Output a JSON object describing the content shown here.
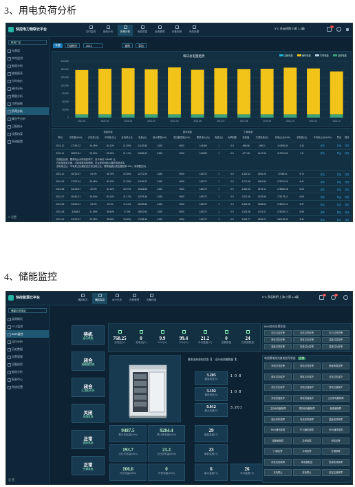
{
  "section3": {
    "title": "3、用电负荷分析",
    "app_name": "快控电力物联云平台",
    "nav": [
      "实时监测",
      "能耗分析",
      "负荷分析",
      "电能质量",
      "运维管理",
      "设备档案",
      "系统设置"
    ],
    "weather": "5°C 多云转阴 小雨 1-3级",
    "sidebar_select": "所有厂区",
    "sidebar": [
      "仪表盘",
      "实时监测",
      "能耗分析",
      "能耗报表",
      "分时电价",
      "碳排分析",
      "需量分析",
      "功率因数",
      "负荷分析",
      "峰谷平分析",
      "日报统计",
      "设备档案",
      "系统配置"
    ],
    "sidebar_active_index": 8,
    "sidebar_footer": "© 设置",
    "filter": {
      "tab1": "年度",
      "tab2": "日度统计",
      "year": "2021",
      "query": "查询",
      "export": "导出"
    },
    "chart_data": {
      "type": "bar",
      "title": "每日总电量趋势",
      "legend": [
        "尖峰电量",
        "峰时电量",
        "平时电量",
        "谷时电量"
      ],
      "legend_colors": [
        "#1db5d8",
        "#f2c41a",
        "#b6cde0",
        "#3aa37a"
      ],
      "categories": [
        "2021-01",
        "2021-02",
        "2021-03",
        "2021-04",
        "2021-05",
        "2021-06",
        "2021-07",
        "2021-08",
        "2021-09",
        "2021-10",
        "2021-11",
        "2021-12"
      ],
      "y_ticks": [
        "210,000",
        "180,000",
        "150,000",
        "120,000",
        "90,000",
        "60,000",
        "30,000",
        "0"
      ],
      "series": [
        {
          "name": "峰时电量",
          "values": [
            165000,
            170000,
            172000,
            168000,
            175000,
            166000,
            172000,
            169000,
            170000,
            174000,
            171000,
            160000
          ]
        },
        {
          "name": "谷时电量",
          "values": [
            12000,
            12000,
            12000,
            12000,
            12000,
            12000,
            12000,
            12000,
            12000,
            12000,
            12000,
            12000
          ]
        }
      ],
      "ylim": [
        0,
        210000
      ]
    },
    "table": {
      "group_headers": [
        "电量电费",
        "基本电费",
        "力调电费"
      ],
      "headers": [
        "时间",
        "总电量(kWh)",
        "尖电量占比",
        "平电量占比",
        "谷电量占比",
        "电费(元)",
        "最大需量(kW)",
        "变压器容量(kVA)",
        "需量电价(元)",
        "电费(元)",
        "功率因数",
        "标准值",
        "力调电费(元)",
        "总电价(元/kWh)",
        "总电费(元)",
        "平均电价(元/kWh)",
        "导出",
        "操作"
      ],
      "rows": [
        [
          "2021-12",
          "27190.72",
          "26.45%",
          "50.12%",
          "21.29%",
          "13139.58",
          "2435",
          "9000",
          "104286",
          "1",
          "0.9",
          "-666.56",
          "1495.1",
          "110695.04",
          "4.34",
          "详情",
          "导出",
          "详情"
        ],
        [
          "2021-11",
          "26570.24",
          "29.54%",
          "33.15%",
          "21.17%",
          "12655.22",
          "2435",
          "9000",
          "104286",
          "1",
          "0.9",
          "-677.26",
          "1417.66",
          "117301.63",
          "4.5",
          "详情",
          "导出",
          "详情"
        ],
        [
          "2021-10",
          "26732.57",
          "24.9%",
          "46.73%",
          "22.05%",
          "12712.29",
          "2435",
          "9000",
          "162372",
          "1",
          "0.9",
          "-1320.02",
          "1690.25",
          "176454.1",
          "5.74",
          "详情",
          "导出",
          "详情"
        ],
        [
          "2021-09",
          "27237.54",
          "26.45%",
          "50.12%",
          "21.29%",
          "13169.27",
          "2435",
          "9000",
          "162372",
          "1",
          "0.9",
          "-1271.06",
          "1581.56",
          "175791.91",
          "6.41",
          "详情",
          "导出",
          "详情"
        ],
        [
          "2021-08",
          "34149.07",
          "22.9%",
          "40.12%",
          "16.97%",
          "16426.58",
          "2435",
          "9000",
          "162372",
          "1",
          "0.9",
          "-1340.06",
          "1879.14",
          "178550.06",
          "5.25",
          "详情",
          "导出",
          "详情"
        ],
        [
          "2021-07",
          "26181.31",
          "26.54%",
          "50.12%",
          "21.17%",
          "12675.38",
          "2435",
          "9000",
          "162372",
          "1",
          "0.9",
          "-1312.06",
          "1425.55",
          "175175.11",
          "6.69",
          "详情",
          "导出",
          "详情"
        ],
        [
          "2021-06",
          "33220.31",
          "23.5%",
          "29.1%",
          "17.41%",
          "16053.82",
          "2435",
          "9000",
          "162372",
          "1",
          "0.9",
          "-1326.06",
          "1835.63",
          "178901.21",
          "5.37",
          "详情",
          "导出",
          "详情"
        ],
        [
          "2021-05",
          "32068.2",
          "21.09%",
          "39.54%",
          "17.3%",
          "15622.84",
          "2435",
          "9000",
          "162372",
          "1",
          "0.9",
          "-1323.06",
          "1761.01",
          "178235.73",
          "5.56",
          "详情",
          "导出",
          "详情"
        ],
        [
          "2021-04",
          "31237.67",
          "26.25%",
          "39.66%",
          "16.89%",
          "17998.46",
          "2435",
          "9000",
          "162372",
          "1",
          "0.9",
          "-1349.77",
          "1826.07",
          "180448.59",
          "5.41",
          "详情",
          "导出",
          "详情"
        ]
      ],
      "note_lines": [
        "在峰谷比例、需求电价分时段影响下，对于每月 156485 元，",
        "在用电费用方面，当前调整用电策略，在谷电时间段以降低电费成本。",
        "总电量占比：平电量占比偏高至达到当前占比；需量值超出变压器容量 40%，有调整空间。"
      ]
    }
  },
  "section4": {
    "title": "4、储能监控",
    "app_name": "快控能源云平台",
    "nav": [
      "储能概况",
      "储能监控",
      "运行分析",
      "告警管理",
      "设备档案"
    ],
    "nav_active_index": 1,
    "weather": "5°C 多云转阴 上海 小雨 1-3级",
    "sidebar_select": "储能示范电站",
    "sidebar": [
      "监测概况",
      "PCS监控",
      "BMS监控",
      "运行分析",
      "历史数据",
      "告警管理",
      "设备档案",
      "能效分析",
      "报表中心",
      "系统设置"
    ],
    "sidebar_active_index": 2,
    "sidebar_footer": "设 置",
    "status_cards": [
      {
        "value": "待机",
        "label": "运行状态"
      },
      {
        "value": "闭合",
        "label": "接触器状态"
      },
      {
        "value": "闭合",
        "label": "汇流柜开关"
      },
      {
        "value": "关闭",
        "label": "风扇状态"
      },
      {
        "value": "正常",
        "label": "消防状态"
      },
      {
        "value": "正常",
        "label": "空调状态"
      }
    ],
    "kpis": [
      {
        "value": "768.25",
        "label": "总电压(V)"
      },
      {
        "value": "0",
        "label": "总电流(A)"
      },
      {
        "value": "9.9",
        "label": "SOC(%)"
      },
      {
        "value": "99.4",
        "label": "SOH(%)"
      },
      {
        "value": "21.2",
        "label": "平均温度(℃)"
      },
      {
        "value": "0",
        "label": "告警数量"
      },
      {
        "value": "24",
        "label": "在线簇数量"
      }
    ],
    "cluster_status": {
      "label1": "簇电池充放电状态",
      "val1": "1",
      "label2": "运行电池簇数量",
      "val2": "1"
    },
    "cell_stats": [
      {
        "value": "3.205",
        "label": "最高电压(V)",
        "sub": "1  0  8"
      },
      {
        "value": "3.192",
        "label": "最低电压(V)",
        "sub": "1  0  8"
      },
      {
        "value": "0.012",
        "label": "最大压差(V)",
        "sub": "3.201"
      }
    ],
    "energy": [
      {
        "value": "9487.5",
        "label": "累计充电量(kWh)"
      },
      {
        "value": "9284.4",
        "label": "累计放电量(kWh)"
      },
      {
        "value": "193.7",
        "label": "当日充电量(kWh)"
      },
      {
        "value": "21.2",
        "label": "当日放电量(kWh)"
      },
      {
        "value": "166.6",
        "label": "可充电量(kWh)"
      },
      {
        "value": "0",
        "label": "可放电量(kWh)"
      }
    ],
    "temps": [
      {
        "value": "29",
        "label": "最高温度(℃)"
      },
      {
        "value": "23",
        "label": "最低温度(℃)"
      },
      {
        "value": "6",
        "label": "最大温差(℃)"
      },
      {
        "value": "26",
        "label": "平均温度(℃)"
      }
    ],
    "alarm_panel_title": "BMS综合告警状态",
    "alarm_buttons": [
      "总压过高告警",
      "总压过低告警",
      "SOC过低告警",
      "单体过压告警",
      "单体欠压告警",
      "温度过高告警",
      "温度过低告警",
      "压差过大告警",
      "温差过大告警"
    ],
    "relay_panel_title": "电池簇电池充放电信号状态",
    "relay_tag": "正常",
    "relay_buttons": [
      "充电过流告警",
      "放电过流告警",
      "绝缘电阻告警",
      "单体过压保护",
      "单体欠压保护",
      "总压过压保护",
      "总压欠压保护",
      "充电过温保护",
      "放电过温保护",
      "充电低温保护",
      "放电低温保护",
      "主正继电器故障",
      "主负继电器故障",
      "预充继电器故障",
      "断路器故障",
      "高压采样故障",
      "电流采样故障",
      "温度采样故障",
      "BMU通讯故障",
      "PCS通讯故障",
      "EMS通讯故障",
      "熔断器故障",
      "急停故障",
      "消防告警",
      "门禁告警",
      "水浸告警",
      "空调故障",
      "系统自检故障",
      "继电器粘连",
      "绝缘检测故障",
      "充电禁止",
      "放电禁止",
      "高压互锁故障"
    ]
  }
}
